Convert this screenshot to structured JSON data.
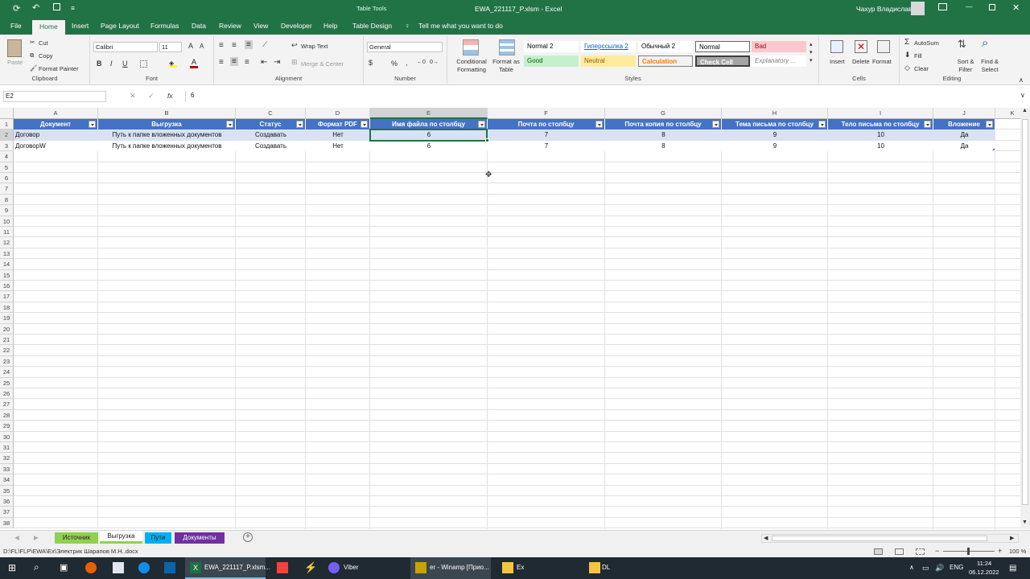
{
  "window": {
    "title": "EWA_221117_P.xlsm - Excel",
    "context_tab_group": "Table Tools",
    "user": "Чахур Владислав"
  },
  "ribbon_tabs": [
    "File",
    "Home",
    "Insert",
    "Page Layout",
    "Formulas",
    "Data",
    "Review",
    "View",
    "Developer",
    "Help",
    "Table Design"
  ],
  "tell_me": "Tell me what you want to do",
  "clipboard": {
    "paste": "Paste",
    "cut": "Cut",
    "copy": "Copy",
    "format_painter": "Format Painter",
    "label": "Clipboard"
  },
  "font": {
    "name": "Calibri",
    "size": "11",
    "label": "Font",
    "bold": "B",
    "italic": "I",
    "underline": "U"
  },
  "alignment": {
    "wrap": "Wrap Text",
    "merge": "Merge & Center",
    "label": "Alignment"
  },
  "number": {
    "format": "General",
    "label": "Number",
    "percent": "%"
  },
  "styles": {
    "conditional": "Conditional Formatting",
    "format_table": "Format as Table",
    "label": "Styles",
    "gallery": [
      {
        "name": "Normal 2",
        "bg": "#ffffff",
        "fg": "#000000"
      },
      {
        "name": "Гиперссылка 2",
        "bg": "#ffffff",
        "fg": "#0563c1"
      },
      {
        "name": "Обычный 2",
        "bg": "#ffffff",
        "fg": "#000000"
      },
      {
        "name": "Normal",
        "bg": "#ffffff",
        "fg": "#000000"
      },
      {
        "name": "Bad",
        "bg": "#ffc7ce",
        "fg": "#9c0006"
      },
      {
        "name": "Good",
        "bg": "#c6efce",
        "fg": "#006100"
      },
      {
        "name": "Neutral",
        "bg": "#ffeb9c",
        "fg": "#9c5700"
      },
      {
        "name": "Calculation",
        "bg": "#f2f2f2",
        "fg": "#fa7d00"
      },
      {
        "name": "Check Cell",
        "bg": "#a5a5a5",
        "fg": "#ffffff"
      },
      {
        "name": "Explanatory ...",
        "bg": "#ffffff",
        "fg": "#7f7f7f"
      }
    ]
  },
  "cells": {
    "insert": "Insert",
    "delete": "Delete",
    "format": "Format",
    "label": "Cells"
  },
  "editing": {
    "autosum": "AutoSum",
    "fill": "Fill",
    "clear": "Clear",
    "sort": "Sort & Filter",
    "find": "Find & Select",
    "label": "Editing"
  },
  "formula_bar": {
    "name_box": "E2",
    "value": "6",
    "fx": "fx"
  },
  "columns": [
    "A",
    "B",
    "C",
    "D",
    "E",
    "F",
    "G",
    "H",
    "I",
    "J",
    "K"
  ],
  "selected_column": "E",
  "table": {
    "headers": [
      "Документ",
      "Выгрузка",
      "Статус",
      "Формат PDF",
      "Имя файла по столбцу",
      "Почта по столбцу",
      "Почта копия по столбцу",
      "Тема письма по столбцу",
      "Тело письма по столбцу",
      "Вложение"
    ],
    "rows": [
      [
        "Договор",
        "Путь к папке вложенных документов",
        "Создавать",
        "Нет",
        "6",
        "7",
        "8",
        "9",
        "10",
        "Да"
      ],
      [
        "ДоговорW",
        "Путь к папке вложенных документов",
        "Создавать",
        "Нет",
        "6",
        "7",
        "8",
        "9",
        "10",
        "Да"
      ]
    ]
  },
  "row_numbers": [
    "1",
    "2",
    "3",
    "4",
    "5",
    "6",
    "7",
    "8",
    "9",
    "10",
    "11",
    "12",
    "13",
    "14",
    "15",
    "16",
    "17",
    "18",
    "19",
    "20",
    "21",
    "22",
    "23",
    "24",
    "25",
    "26",
    "27",
    "28",
    "29",
    "30",
    "31",
    "32",
    "33",
    "34",
    "35",
    "36",
    "37",
    "38"
  ],
  "sheets": [
    {
      "name": "Источник",
      "color": "#92d050"
    },
    {
      "name": "Выгрузка",
      "color": "#92d050"
    },
    {
      "name": "Пути",
      "color": "#00b0f0"
    },
    {
      "name": "Документы",
      "color": "#7030a0"
    }
  ],
  "status_bar": {
    "path": "D:\\FL\\FLP\\EWA\\Ex\\Электрик Шарапов М.Н..docx",
    "zoom": "100 %"
  },
  "taskbar": {
    "apps": [
      "EWA_221117_P.xlsm...",
      "Viber",
      "er - Winamp [Прио...",
      "Ex",
      "DL"
    ],
    "lang": "ENG",
    "time": "11:24",
    "date": "06.12.2022"
  }
}
